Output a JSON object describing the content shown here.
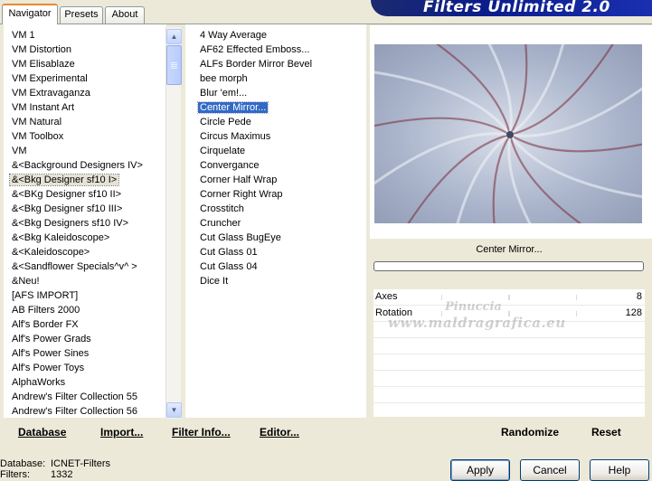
{
  "tabs": [
    {
      "label": "Navigator",
      "active": true
    },
    {
      "label": "Presets",
      "active": false
    },
    {
      "label": "About",
      "active": false
    }
  ],
  "banner": {
    "title": "Filters Unlimited 2.0"
  },
  "categories": [
    {
      "label": "VM 1"
    },
    {
      "label": "VM Distortion"
    },
    {
      "label": "VM Elisablaze"
    },
    {
      "label": "VM Experimental"
    },
    {
      "label": "VM Extravaganza"
    },
    {
      "label": "VM Instant Art"
    },
    {
      "label": "VM Natural"
    },
    {
      "label": "VM Toolbox"
    },
    {
      "label": "VM"
    },
    {
      "label": "&<Background Designers IV>"
    },
    {
      "label": "&<Bkg Designer sf10 I>",
      "selected": true
    },
    {
      "label": "&<BKg Designer sf10 II>"
    },
    {
      "label": "&<Bkg Designer sf10 III>"
    },
    {
      "label": "&<Bkg Designers sf10 IV>"
    },
    {
      "label": "&<Bkg Kaleidoscope>"
    },
    {
      "label": "&<Kaleidoscope>"
    },
    {
      "label": "&<Sandflower Specials^v^ >"
    },
    {
      "label": "&Neu!"
    },
    {
      "label": "[AFS IMPORT]"
    },
    {
      "label": "AB Filters 2000"
    },
    {
      "label": "Alf's Border FX"
    },
    {
      "label": "Alf's Power Grads"
    },
    {
      "label": "Alf's Power Sines"
    },
    {
      "label": "Alf's Power Toys"
    },
    {
      "label": "AlphaWorks"
    },
    {
      "label": "Andrew's Filter Collection 55"
    },
    {
      "label": "Andrew's Filter Collection 56"
    }
  ],
  "filters": [
    {
      "label": "4 Way Average"
    },
    {
      "label": "AF62 Effected Emboss..."
    },
    {
      "label": "ALFs Border Mirror Bevel"
    },
    {
      "label": "bee morph"
    },
    {
      "label": "Blur 'em!..."
    },
    {
      "label": "Center Mirror...",
      "selected": true
    },
    {
      "label": "Circle Pede"
    },
    {
      "label": "Circus Maximus"
    },
    {
      "label": "Cirquelate"
    },
    {
      "label": "Convergance"
    },
    {
      "label": "Corner Half Wrap"
    },
    {
      "label": "Corner Right Wrap"
    },
    {
      "label": "Crosstitch"
    },
    {
      "label": "Cruncher"
    },
    {
      "label": "Cut Glass  BugEye"
    },
    {
      "label": "Cut Glass 01"
    },
    {
      "label": "Cut Glass 04"
    },
    {
      "label": "Dice It"
    }
  ],
  "preview": {
    "filter_name": "Center Mirror...",
    "progress": 0
  },
  "params": [
    {
      "label": "Axes",
      "value": "8"
    },
    {
      "label": "Rotation",
      "value": "128"
    }
  ],
  "watermark": {
    "line1": "Pinuccia",
    "line2": "www.maldragrafica.eu"
  },
  "links": {
    "database": "Database",
    "import": "Import...",
    "filter_info": "Filter Info...",
    "editor": "Editor...",
    "randomize": "Randomize",
    "reset": "Reset"
  },
  "status": {
    "database_label": "Database:",
    "database_value": "ICNET-Filters",
    "filters_label": "Filters:",
    "filters_value": "1332"
  },
  "buttons": {
    "apply": "Apply",
    "cancel": "Cancel",
    "help": "Help"
  },
  "colors": {
    "dialog_bg": "#ece9d8",
    "selection_blue": "#316ac5",
    "banner_blue": "#0b1d8a",
    "tab_highlight": "#e68b2c"
  }
}
